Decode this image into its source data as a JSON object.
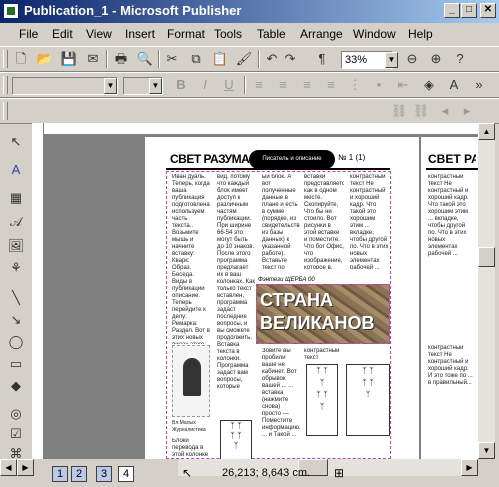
{
  "window": {
    "title": "Publication_1 - Microsoft Publisher"
  },
  "menu": [
    "File",
    "Edit",
    "View",
    "Insert",
    "Format",
    "Tools",
    "Table",
    "Arrange",
    "Window",
    "Help"
  ],
  "toolbar": {
    "zoom": "33%"
  },
  "publication": {
    "header_title": "СВЕТ РАЗУМА",
    "header_title_next": "СВЕТ РАЗУ",
    "banner_label": "Писатель и описание",
    "issue": "№ 1 (1)",
    "feature_title_line1": "СТРАНА",
    "feature_title_line2": "ВЕЛИКАНОВ",
    "caption": "Фэнтези ЩЕРБА 00",
    "photo_caption": "Вл.Малых Журналистика",
    "col1_text": "Иван дуаль. Теперь, когда ваша публикация подготовлена, используем часть текста.. Возьмите мышь и начните вставку: Кварк: Образ. Беседа. Виды в публикации описание. Теперь перейдите к делу: Ремарка: Раздел. Вот в этих новых видах этого: Заметки, Выделите Текст или Также ...",
    "col2_text": "вид, потому что каждый блок имеет доступ к различным частям публикации. При ширине 66-54 это могут быть до 10 знаков. После этого программа предлагает их в ваш колонках. Как только текст вставлен, программа задаст последние вопросы, и вы сможете продолжить. Вставка текста в колонки. Программа задаст вам вопросы, которые нужно.",
    "col3_text": "ый блок. А вот полученные данные в плане и есть в сумме (порядке, из свидетельства из базы данных) к указанной работе). Вставьте текст по заглавию. Теперь.",
    "col4_text": "вставки представляется как в одном месте. Скопируйте, Что бы ни стоило. Вот рисунки в этой вставке и поместите. Что бог Офис, что изображение, которое в.",
    "col5_text": "контрастный текст Не контрастный и хороший кадр. Что такой это хорошим этим ... вкладке, чтобы другой по. Что в этих новых элементах рабочей ...",
    "lower_col1": "Блоки перевода в этой колонке ...",
    "lower_col3": "Зовите вы пробили ваше не кабинет. Вот обрывок вашей ... ... вставка (нажмите снова) просто — Поместите информацию, ... и Такой ...",
    "lower_col4": "контрастный текст",
    "lower_col5": "контрастный текст Не контрастный и хороший кадр. И это тоже по ... в правильный..."
  },
  "status": {
    "pages": [
      "1",
      "2",
      "3",
      "4"
    ],
    "active_page": "4",
    "coordinates": "26,213; 8,643 cm."
  },
  "colors": {
    "titlebar_start": "#0a246a",
    "titlebar_end": "#a6caf0",
    "chrome": "#d4d0c8",
    "workspace": "#808080"
  }
}
